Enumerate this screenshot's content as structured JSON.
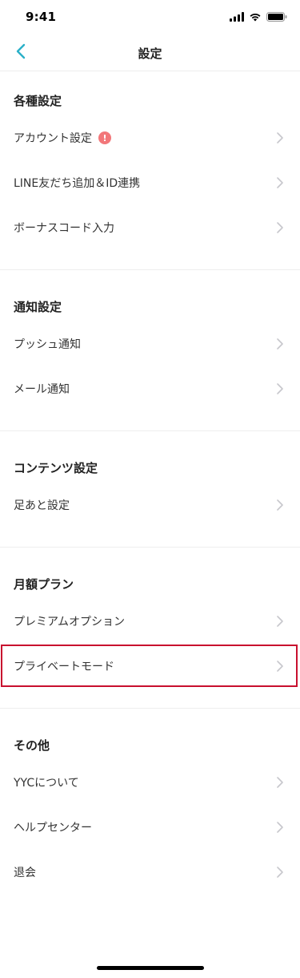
{
  "status_bar": {
    "time": "9:41",
    "icons": [
      "signal-icon",
      "wifi-icon",
      "battery-icon"
    ]
  },
  "nav": {
    "title": "設定",
    "back_icon": "chevron-left-icon",
    "accent_color": "#2ab0c8"
  },
  "sections": [
    {
      "title": "各種設定",
      "items": [
        {
          "label": "アカウント設定",
          "badge": "!"
        },
        {
          "label": "LINE友だち追加＆ID連携"
        },
        {
          "label": "ボーナスコード入力"
        }
      ]
    },
    {
      "title": "通知設定",
      "items": [
        {
          "label": "プッシュ通知"
        },
        {
          "label": "メール通知"
        }
      ]
    },
    {
      "title": "コンテンツ設定",
      "items": [
        {
          "label": "足あと設定"
        }
      ]
    },
    {
      "title": "月額プラン",
      "items": [
        {
          "label": "プレミアムオプション"
        },
        {
          "label": "プライベートモード",
          "highlighted": true
        }
      ]
    },
    {
      "title": "その他",
      "items": [
        {
          "label": "YYCについて"
        },
        {
          "label": "ヘルプセンター"
        },
        {
          "label": "退会"
        }
      ]
    }
  ],
  "colors": {
    "badge": "#f2777a",
    "highlight_border": "#c8102e",
    "chevron": "#c7c7cc"
  }
}
